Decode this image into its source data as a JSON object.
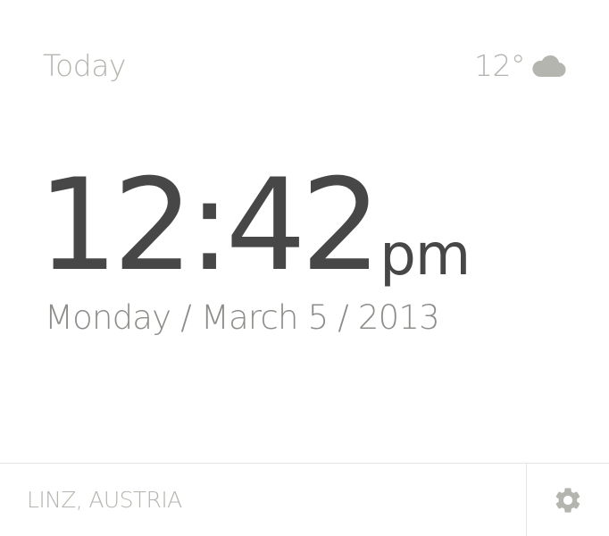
{
  "header": {
    "label": "Today"
  },
  "weather": {
    "temperature": "12°",
    "icon": "cloud-icon"
  },
  "clock": {
    "time": "12:42",
    "period": "pm",
    "date": "Monday / March 5 / 2013"
  },
  "footer": {
    "location": "LINZ, AUSTRIA",
    "settings_icon": "gear-icon"
  },
  "colors": {
    "primary_text": "#474747",
    "secondary_text": "#8c8c88",
    "muted_text": "#b5b5b0",
    "divider": "#e4e4e2"
  }
}
